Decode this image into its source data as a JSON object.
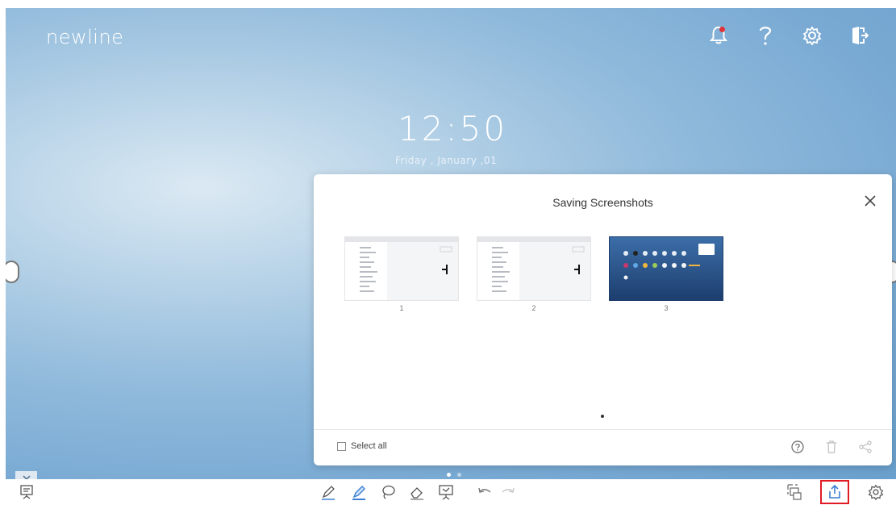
{
  "brand": {
    "logo_text": "newline"
  },
  "top_bar": {
    "icons": [
      "notification-icon",
      "help-icon",
      "settings-icon",
      "exit-icon"
    ],
    "notification_color": "#e0323a"
  },
  "clock": {
    "time": "12:50",
    "date": "Friday , January ,01"
  },
  "dialog": {
    "title": "Saving Screenshots",
    "screenshots": [
      {
        "label": "1",
        "style": "light"
      },
      {
        "label": "2",
        "style": "light"
      },
      {
        "label": "3",
        "style": "dark"
      }
    ],
    "select_all_label": "Select all",
    "select_all_checked": false,
    "footer_icons": [
      "help-icon",
      "delete-icon",
      "share-icon"
    ]
  },
  "toolbar": {
    "left": [
      "presentation-icon"
    ],
    "center": [
      "pen-icon",
      "highlighter-icon",
      "lasso-icon",
      "eraser-icon",
      "whiteboard-icon",
      "undo-icon",
      "redo-icon"
    ],
    "right": [
      "screenshot-icon",
      "upload-icon",
      "settings-icon"
    ],
    "highlighted": "upload-icon",
    "highlight_color": "#e01b24"
  },
  "colors": {
    "accent_blue": "#3b7fd3",
    "background": "#8fb8db"
  }
}
